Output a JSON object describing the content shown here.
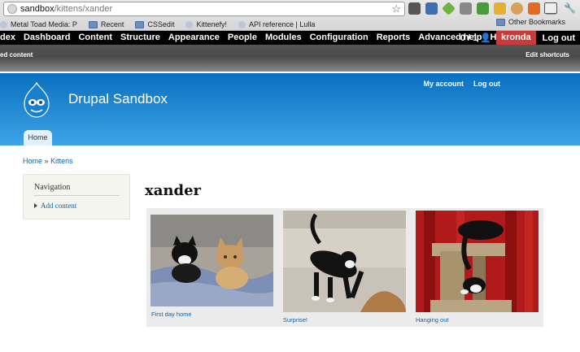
{
  "browser": {
    "url_host": "sandbox",
    "url_path": "/kittens/xander",
    "bookmarks": [
      {
        "label": "Metal Toad Media: P",
        "icon": "favicon"
      },
      {
        "label": "Recent",
        "icon": "folder-icon"
      },
      {
        "label": "CSSedit",
        "icon": "folder-icon"
      },
      {
        "label": "Kittenefy!",
        "icon": "favicon"
      },
      {
        "label": "API reference | Lulla",
        "icon": "favicon"
      }
    ],
    "other_bookmarks": "Other Bookmarks"
  },
  "admin_toolbar": {
    "items": [
      "dex",
      "Dashboard",
      "Content",
      "Structure",
      "Appearance",
      "People",
      "Modules",
      "Configuration",
      "Reports",
      "Advanced help",
      "Help"
    ],
    "count": "0 / 1",
    "user": "kronda",
    "logout": "Log out",
    "shortcut_left": "ed content",
    "shortcut_right": "Edit shortcuts"
  },
  "header": {
    "site_name": "Drupal Sandbox",
    "my_account": "My account",
    "log_out": "Log out",
    "home_tab": "Home"
  },
  "breadcrumb": {
    "home": "Home",
    "separator": "»",
    "current": "Kittens"
  },
  "sidebar": {
    "title": "Navigation",
    "link": "Add content"
  },
  "page": {
    "title": "xander"
  },
  "gallery": [
    {
      "caption": "First day home"
    },
    {
      "caption": "Surprise!"
    },
    {
      "caption": "Hanging out"
    }
  ],
  "colors": {
    "accent_blue": "#0f62b0",
    "header_top": "#0a6fc0",
    "header_bottom": "#3da4e6",
    "user_badge": "#c73b3b"
  }
}
